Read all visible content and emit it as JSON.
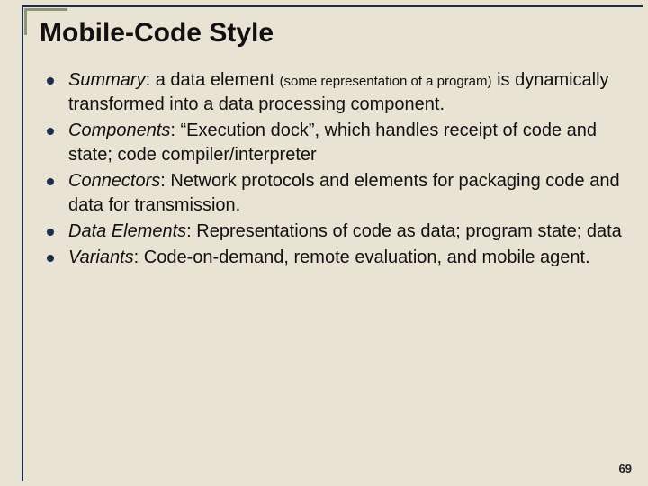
{
  "title": "Mobile-Code Style",
  "bullets": [
    {
      "term": "Summary",
      "lead": ": a data element ",
      "small": "(some representation of a program)",
      "rest": " is dynamically transformed into a data processing component."
    },
    {
      "term": "Components",
      "lead": ": “Execution dock”, which handles receipt of code and state; code compiler/interpreter",
      "small": "",
      "rest": ""
    },
    {
      "term": "Connectors",
      "lead": ": Network protocols and elements for packaging code and data for transmission.",
      "small": "",
      "rest": ""
    },
    {
      "term": "Data Elements",
      "lead": ": Representations of code as data; program state; data",
      "small": "",
      "rest": ""
    },
    {
      "term": "Variants",
      "lead": ": Code-on-demand, remote evaluation, and mobile agent.",
      "small": "",
      "rest": ""
    }
  ],
  "pageNumber": "69"
}
